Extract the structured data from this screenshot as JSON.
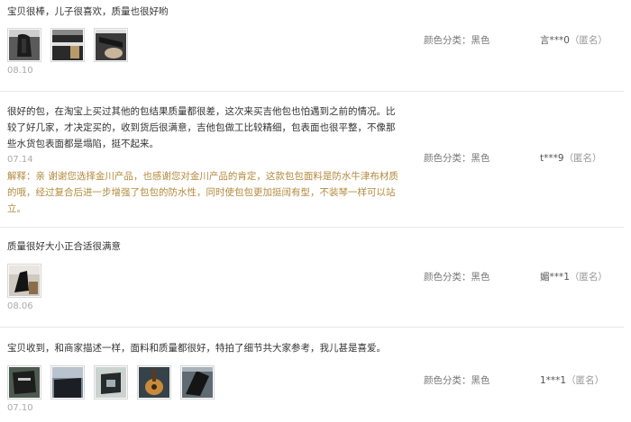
{
  "reviews": [
    {
      "text": "宝贝很棒，儿子很喜欢，质量也很好哟",
      "date": "08.10",
      "attr_label": "颜色分类：",
      "attr_value": "黑色",
      "user": "言***0",
      "anon": "（匿名）",
      "photos": [
        "guitar-bag-photo",
        "bag-zipper-photo",
        "bag-strap-photo"
      ]
    },
    {
      "text": "很好的包，在淘宝上买过其他的包结果质量都很差，这次来买吉他包也怕遇到之前的情况。比较了好几家，才决定买的，收到货后很满意，吉他包做工比较精细，包表面也很平整，不像那些水货包表面都是塌陷，挺不起来。",
      "date": "07.14",
      "reply": "解释：亲 谢谢您选择金川产品，也感谢您对金川产品的肯定，这款包包面料是防水牛津布材质的哦，经过复合后进一步增强了包包的防水性，同时使包包更加挺阔有型，不装琴一样可以站立。",
      "attr_label": "颜色分类：",
      "attr_value": "黑色",
      "user": "t***9",
      "anon": "（匿名）"
    },
    {
      "text": "质量很好大小正合适很满意",
      "date": "08.06",
      "attr_label": "颜色分类：",
      "attr_value": "黑色",
      "user": "媚***1",
      "anon": "（匿名）",
      "photos": [
        "bag-on-chair-photo"
      ]
    },
    {
      "text": "宝贝收到，和商家描述一样，面料和质量都很好，特拍了细节共大家参考，我儿甚是喜爱。",
      "date": "07.10",
      "attr_label": "颜色分类：",
      "attr_value": "黑色",
      "user": "1***1",
      "anon": "（匿名）",
      "photos": [
        "bag-detail-photo-1",
        "bag-detail-photo-2",
        "bag-detail-photo-3",
        "ukulele-photo",
        "bag-detail-photo-5"
      ]
    }
  ]
}
